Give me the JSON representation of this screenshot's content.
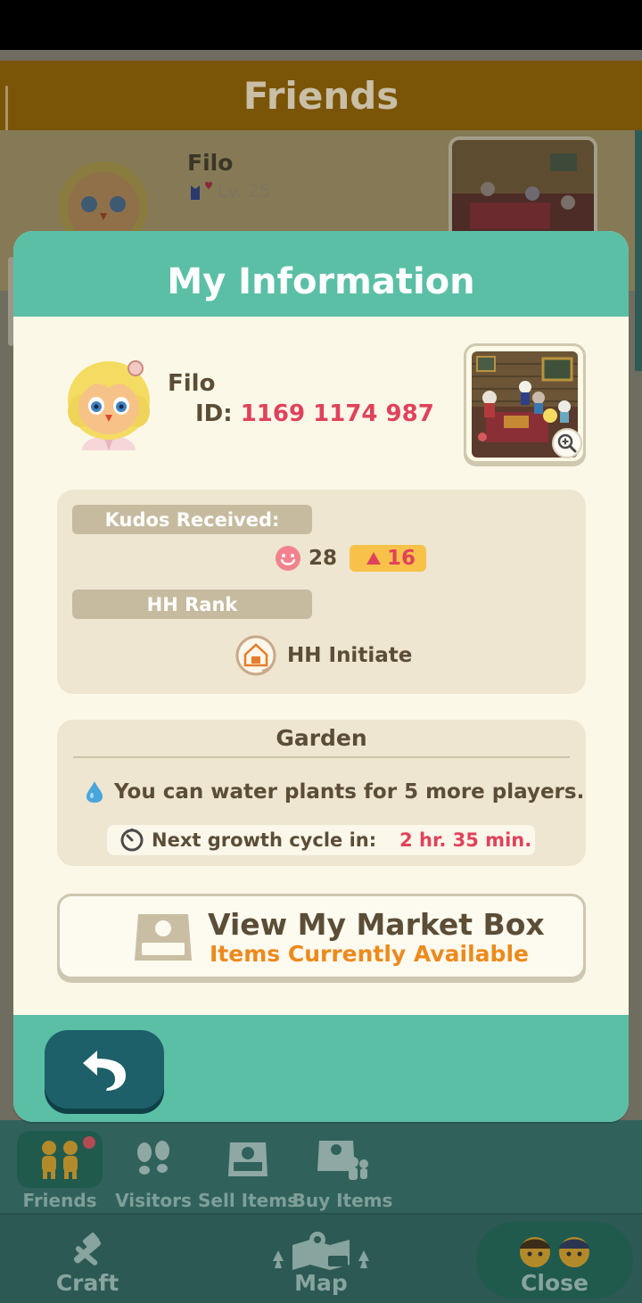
{
  "background": {
    "header_title": "Friends",
    "friend": {
      "name": "Filo",
      "level": "Lv. 25"
    }
  },
  "modal": {
    "title": "My Information",
    "profile": {
      "name": "Filo",
      "id_label": "ID:",
      "id_value": "1169 1174 987"
    },
    "kudos": {
      "label": "Kudos Received:",
      "count": "28",
      "rank_up": "16"
    },
    "hh_rank": {
      "label": "HH Rank",
      "value": "HH Initiate"
    },
    "garden": {
      "title": "Garden",
      "water_text": "You can water plants for 5 more players.",
      "cycle_label": "Next growth cycle in:",
      "cycle_value": "2 hr. 35 min."
    },
    "market": {
      "title": "View My Market Box",
      "subtitle": "Items Currently Available"
    }
  },
  "subnav": {
    "items": [
      {
        "label": "Friends",
        "icon": "friends-icon"
      },
      {
        "label": "Visitors",
        "icon": "footprints-icon"
      },
      {
        "label": "Sell Items",
        "icon": "market-box-icon"
      },
      {
        "label": "Buy Items",
        "icon": "buy-items-icon"
      }
    ]
  },
  "mainnav": {
    "items": [
      {
        "label": "Craft",
        "icon": "hammer-icon"
      },
      {
        "label": "Map",
        "icon": "map-icon"
      },
      {
        "label": "Close",
        "icon": "villagers-icon"
      }
    ]
  },
  "colors": {
    "teal": "#5bbfa6",
    "panel": "#eee6d0",
    "accent_red": "#e0425b",
    "accent_orange": "#ec8a1c"
  }
}
